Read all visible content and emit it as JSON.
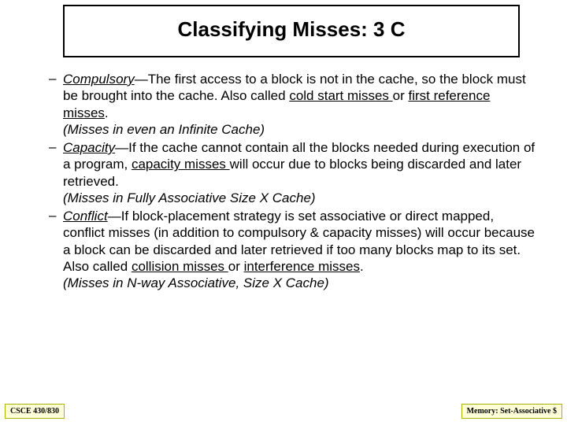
{
  "title": "Classifying Misses: 3 C",
  "items": [
    {
      "term": "Compulsory",
      "mdash": "—",
      "text1": "The first access to a block is not in the cache, so the block must be brought into the cache. Also called ",
      "ul1": "cold start misses ",
      "mid1": "or ",
      "ul2": "first reference misses",
      "tail1": ".",
      "paren": "(Misses in even an Infinite Cache)"
    },
    {
      "term": "Capacity",
      "mdash": "—",
      "text1": "If the cache cannot contain all the blocks needed during execution of a program, ",
      "ul1": "capacity misses ",
      "mid1": "will occur due to blocks being discarded and later retrieved.",
      "ul2": "",
      "tail1": "",
      "paren": "(Misses in Fully Associative Size X Cache)"
    },
    {
      "term": "Conflict",
      "mdash": "—",
      "text1": "If block-placement strategy is set associative or direct mapped, conflict misses (in addition to compulsory & capacity misses) will occur because a block can be discarded and later retrieved if too many blocks map to its set. Also called ",
      "ul1": "collision misses ",
      "mid1": "or ",
      "ul2": "interference misses",
      "tail1": ".",
      "paren": "(Misses in N-way Associative, Size X Cache)"
    }
  ],
  "footer": {
    "left": "CSCE 430/830",
    "right": "Memory: Set-Associative $"
  }
}
